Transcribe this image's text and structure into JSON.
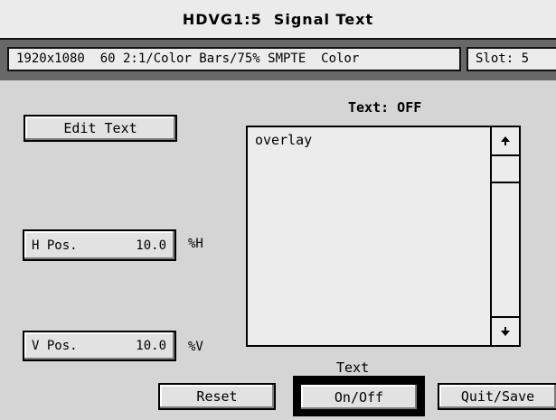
{
  "window": {
    "title": "HDVG1:5  Signal Text"
  },
  "status": {
    "format": "1920x1080  60 2:1/Color Bars/75% SMPTE  Color",
    "slot": "Slot: 5"
  },
  "controls": {
    "edit_text_label": "Edit Text",
    "h_pos": {
      "label": "H Pos.",
      "value": "10.0",
      "unit": "%H"
    },
    "v_pos": {
      "label": "V Pos.",
      "value": "10.0",
      "unit": "%V"
    }
  },
  "text_panel": {
    "status": "Text: OFF",
    "content": "overlay",
    "scroll_up_icon": "arrow-up-icon",
    "scroll_down_icon": "arrow-down-icon"
  },
  "footer": {
    "reset_label": "Reset",
    "text_onoff_caption": "Text",
    "text_onoff_label": "On/Off",
    "quit_save_label": "Quit/Save"
  }
}
